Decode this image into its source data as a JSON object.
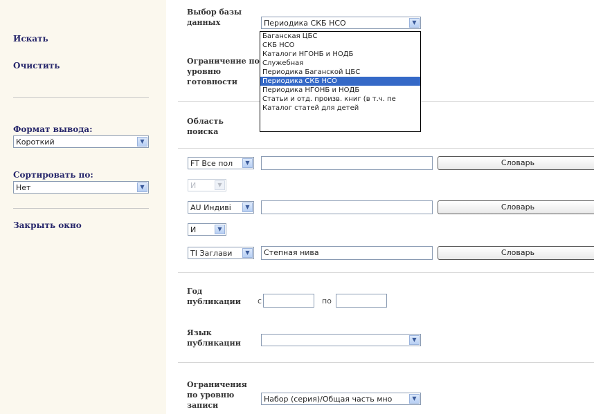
{
  "sidebar": {
    "search_link": "Искать",
    "clear_link": "Очистить",
    "format_label": "Формат вывода:",
    "format_value": "Короткий",
    "sort_label": "Сортировать по:",
    "sort_value": "Нет",
    "close_link": "Закрыть окно"
  },
  "database": {
    "label": "Выбор базы данных",
    "selected": "Периодика СКБ НСО",
    "options": [
      "Баганская ЦБС",
      "СКБ НСО",
      "Каталоги НГОНБ и НОДБ",
      "Служебная",
      "Периодика Баганской ЦБС",
      "Периодика СКБ НСО",
      "Периодика НГОНБ и НОДБ",
      "Статьи и отд. произв. книг (в т.ч. пе",
      "Каталог статей для детей"
    ],
    "selected_index": 5
  },
  "readiness": {
    "label": "Ограничение по уровню готовности"
  },
  "search_area": {
    "label": "Область поиска",
    "rows": [
      {
        "field": "FT Все пол",
        "value": "",
        "dict": "Словарь"
      },
      {
        "field": "AU Индиві",
        "value": "",
        "dict": "Словарь"
      },
      {
        "field": "TI Заглави",
        "value": "Степная нива",
        "dict": "Словарь"
      }
    ],
    "operators": [
      "И",
      "И"
    ]
  },
  "year": {
    "label": "Год публикации",
    "from_label": "с",
    "to_label": "по",
    "from": "",
    "to": ""
  },
  "language": {
    "label": "Язык публикации",
    "value": ""
  },
  "record_level": {
    "label": "Ограничения по уровню записи",
    "value": "Набор (серия)/Общая часть мно"
  }
}
